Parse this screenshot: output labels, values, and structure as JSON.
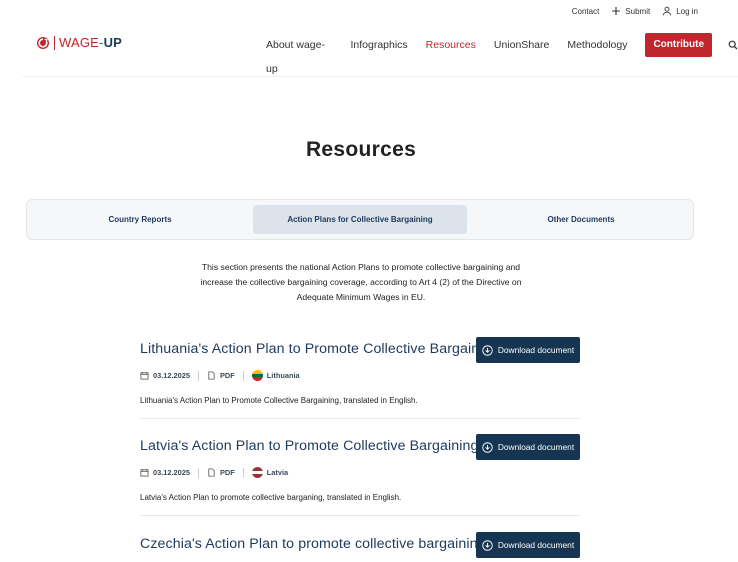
{
  "utility": {
    "contact": "Contact",
    "submit": "Submit",
    "login": "Log in"
  },
  "logo": {
    "prefix": "WAGE-",
    "suffix": "UP"
  },
  "nav": {
    "items": [
      "About wage-up",
      "Infographics",
      "Resources",
      "UnionShare",
      "Methodology"
    ],
    "active": "Resources",
    "contribute": "Contribute"
  },
  "page": {
    "title": "Resources"
  },
  "tabs": [
    "Country Reports",
    "Action Plans for Collective Bargaining",
    "Other Documents"
  ],
  "intro": "This section presents the national Action Plans to promote collective bargaining and increase the collective bargaining coverage, according to Art 4 (2) of the Directive on Adequate Minimum Wages in EU.",
  "resources": [
    {
      "title": "Lithuania's Action Plan to Promote Collective Bargaining",
      "date": "03.12.2025",
      "format": "PDF",
      "country": "Lithuania",
      "description": "Lithuania's Action Plan to Promote Collective Bargaining, translated in English.",
      "button": "Download document"
    },
    {
      "title": "Latvia's Action Plan to Promote Collective Bargaining",
      "date": "03.12.2025",
      "format": "PDF",
      "country": "Latvia",
      "description": "Latvia's Action Plan to promote collective barganing, translated in English.",
      "button": "Download document"
    },
    {
      "title": "Czechia's Action Plan to promote collective bargaining",
      "button": "Download document"
    }
  ],
  "colors": {
    "brand_red": "#c0262d",
    "navy": "#163552",
    "title_blue": "#1d3a5c"
  }
}
